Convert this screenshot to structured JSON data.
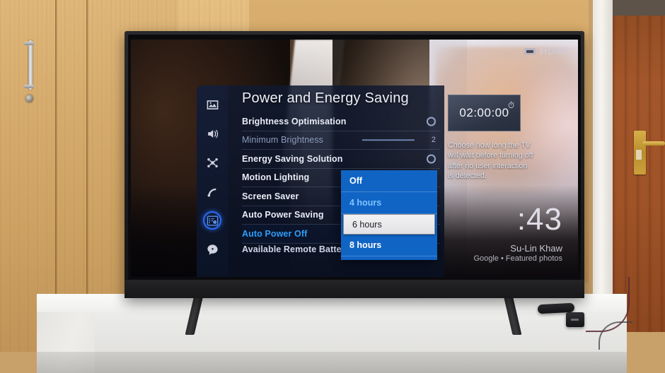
{
  "device": {
    "input_badge": "HDMI",
    "input_icon": "hdmi-connector-icon"
  },
  "screensaver": {
    "clock": ":43",
    "photo_credit_name": "Su-Lin Khaw",
    "photo_credit_source": "Google • Featured photos"
  },
  "sidebar": {
    "items": [
      {
        "name": "picture",
        "icon": "picture-icon",
        "active": false
      },
      {
        "name": "sound",
        "icon": "sound-icon",
        "active": false
      },
      {
        "name": "network",
        "icon": "network-icon",
        "active": false
      },
      {
        "name": "broadcast",
        "icon": "broadcast-icon",
        "active": false
      },
      {
        "name": "general-settings",
        "icon": "settings-list-icon",
        "active": true
      },
      {
        "name": "support",
        "icon": "support-chat-icon",
        "active": false
      }
    ]
  },
  "panel": {
    "title": "Power and Energy Saving",
    "rows": [
      {
        "label": "Brightness Optimisation",
        "control": "circle",
        "state": "normal"
      },
      {
        "label": "Minimum Brightness",
        "control": "slider",
        "value": "2",
        "state": "dim"
      },
      {
        "label": "Energy Saving Solution",
        "control": "circle",
        "state": "normal"
      },
      {
        "label": "Motion Lighting",
        "control": "none",
        "state": "normal"
      },
      {
        "label": "Screen Saver",
        "control": "none",
        "state": "normal"
      },
      {
        "label": "Auto Power Saving",
        "control": "none",
        "state": "normal"
      },
      {
        "label": "Auto Power Off",
        "control": "none",
        "state": "focus"
      },
      {
        "label": "Available Remote Battery",
        "control": "none",
        "state": "clipped"
      }
    ]
  },
  "dropdown": {
    "options": [
      {
        "label": "Off",
        "state": "normal"
      },
      {
        "label": "4 hours",
        "state": "current"
      },
      {
        "label": "6 hours",
        "state": "highlight"
      },
      {
        "label": "8 hours",
        "state": "normal"
      }
    ]
  },
  "info": {
    "timer_value": "02:00:00",
    "timer_icon": "stopwatch-icon",
    "description": "Choose how long the TV will wait before turning off after no user interaction is detected."
  },
  "colors": {
    "accent_blue": "#1064c4",
    "focus_text": "#2f9df7",
    "current_option": "#7fc2ff",
    "panel_bg": "#101a30"
  }
}
